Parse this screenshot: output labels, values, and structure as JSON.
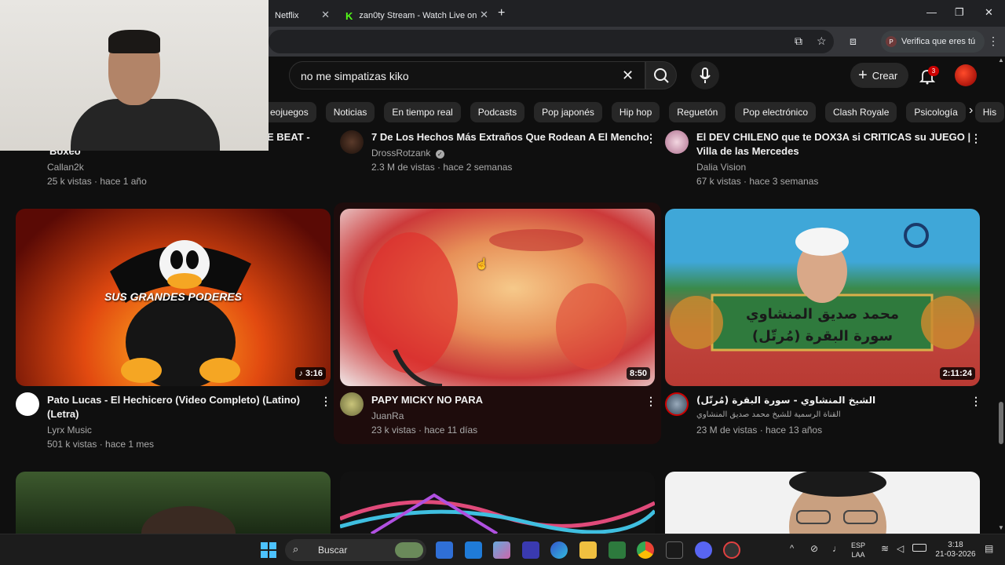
{
  "browser": {
    "tabs": [
      {
        "label": "Netflix"
      },
      {
        "label": "zan0ty Stream - Watch Live on"
      }
    ],
    "verify_label": "Verifica que eres tú"
  },
  "youtube": {
    "search": {
      "query": "no me simpatizas kiko"
    },
    "create_label": "Crear",
    "notifications_count": "3",
    "chips": [
      "eojuegos",
      "Noticias",
      "En tiempo real",
      "Podcasts",
      "Pop japonés",
      "Hip hop",
      "Reguetón",
      "Pop electrónico",
      "Clash Royale",
      "Psicología",
      "His"
    ],
    "row1": [
      {
        "title": "E BEAT -",
        "subtitle": "Boxeo",
        "channel": "Callan2k",
        "meta": "25 k vistas · hace 1 año"
      },
      {
        "title": "7 De Los Hechos Más Extraños Que Rodean A El Mencho",
        "channel": "DrossRotzank",
        "verified": true,
        "meta": "2.3 M de vistas · hace 2 semanas"
      },
      {
        "title_line1": "El DEV CHILENO que te DOX3A si CRITICAS su JUEGO |",
        "title_line2": "Villa de las Mercedes",
        "channel": "Dalia Vision",
        "meta": "67 k vistas · hace 3 semanas"
      }
    ],
    "row2": [
      {
        "thumb_text": "SUS GRANDES PODERES",
        "duration": "3:16",
        "title_line1": "Pato Lucas -  El Hechicero (Video Completo) (Latino)",
        "title_line2": "(Letra)",
        "channel": "Lyrx Music",
        "meta": "501 k vistas · hace 1 mes"
      },
      {
        "duration": "8:50",
        "title": "PAPY MICKY NO PARA",
        "channel": "JuanRa",
        "meta": "23 k vistas · hace 11 días"
      },
      {
        "thumb_line1": "محمد صديق المنشاوي",
        "thumb_line2": "سورة البقرة (مُرتّل)",
        "duration": "2:11:24",
        "title": "الشيخ المنشاوي - سورة البقرة (مُرتّل)",
        "channel": "القناة الرسمية للشيخ محمد صديق المنشاوي",
        "meta": "23 M de vistas · hace 13 años"
      }
    ]
  },
  "taskbar": {
    "search_label": "Buscar",
    "lang_line1": "ESP",
    "lang_line2": "LAA",
    "time": "3:18",
    "date": "21-03-2026"
  }
}
